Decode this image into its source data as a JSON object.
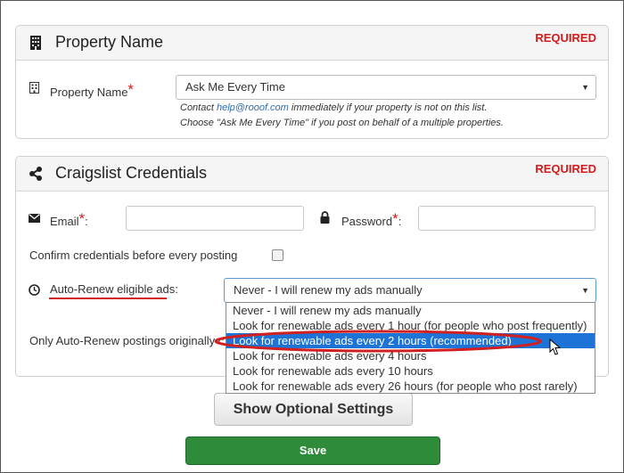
{
  "property_panel": {
    "title": "Property Name",
    "required": "REQUIRED",
    "field_label": "Property Name",
    "field_star": "*",
    "selected_value": "Ask Me Every Time",
    "note_line1_prefix": "Contact ",
    "note_email": "help@rooof.com",
    "note_line1_suffix": " immediately if your property is not on this list.",
    "note_line2": "Choose \"Ask Me Every Time\" if you post on behalf of a multiple properties."
  },
  "credentials_panel": {
    "title": "Craigslist Credentials",
    "required": "REQUIRED",
    "email_label": "Email",
    "email_star": "*",
    "email_colon": ":",
    "email_value": "",
    "password_label": "Password",
    "password_star": "*",
    "password_colon": ":",
    "password_value": "",
    "confirm_label": "Confirm credentials before every posting",
    "confirm_checked": false,
    "autorenew_label": "Auto-Renew eligible ads:",
    "autorenew_value": "Never - I will renew my ads manually",
    "only_autorenew_text": "Only Auto-Renew postings originally c"
  },
  "autorenew_options": [
    {
      "label": "Never - I will renew my ads manually",
      "selected": false
    },
    {
      "label": "Look for renewable ads every 1 hour (for people who post frequently)",
      "selected": false
    },
    {
      "label": "Look for renewable ads every 2 hours (recommended)",
      "selected": true
    },
    {
      "label": "Look for renewable ads every 4 hours",
      "selected": false
    },
    {
      "label": "Look for renewable ads every 10 hours",
      "selected": false
    },
    {
      "label": "Look for renewable ads every 26 hours (for people who post rarely)",
      "selected": false
    }
  ],
  "buttons": {
    "show_optional": "Show Optional Settings",
    "save": "Save"
  },
  "icons": {
    "property": "building-icon",
    "credentials": "share-icon",
    "email": "envelope-icon",
    "password": "lock-icon",
    "autorenew": "clock-icon"
  },
  "colors": {
    "required": "#d41b1b",
    "save_button": "#2e8b3a",
    "selected_option": "#1e74d6",
    "highlight_ellipse": "#d21f1f"
  }
}
